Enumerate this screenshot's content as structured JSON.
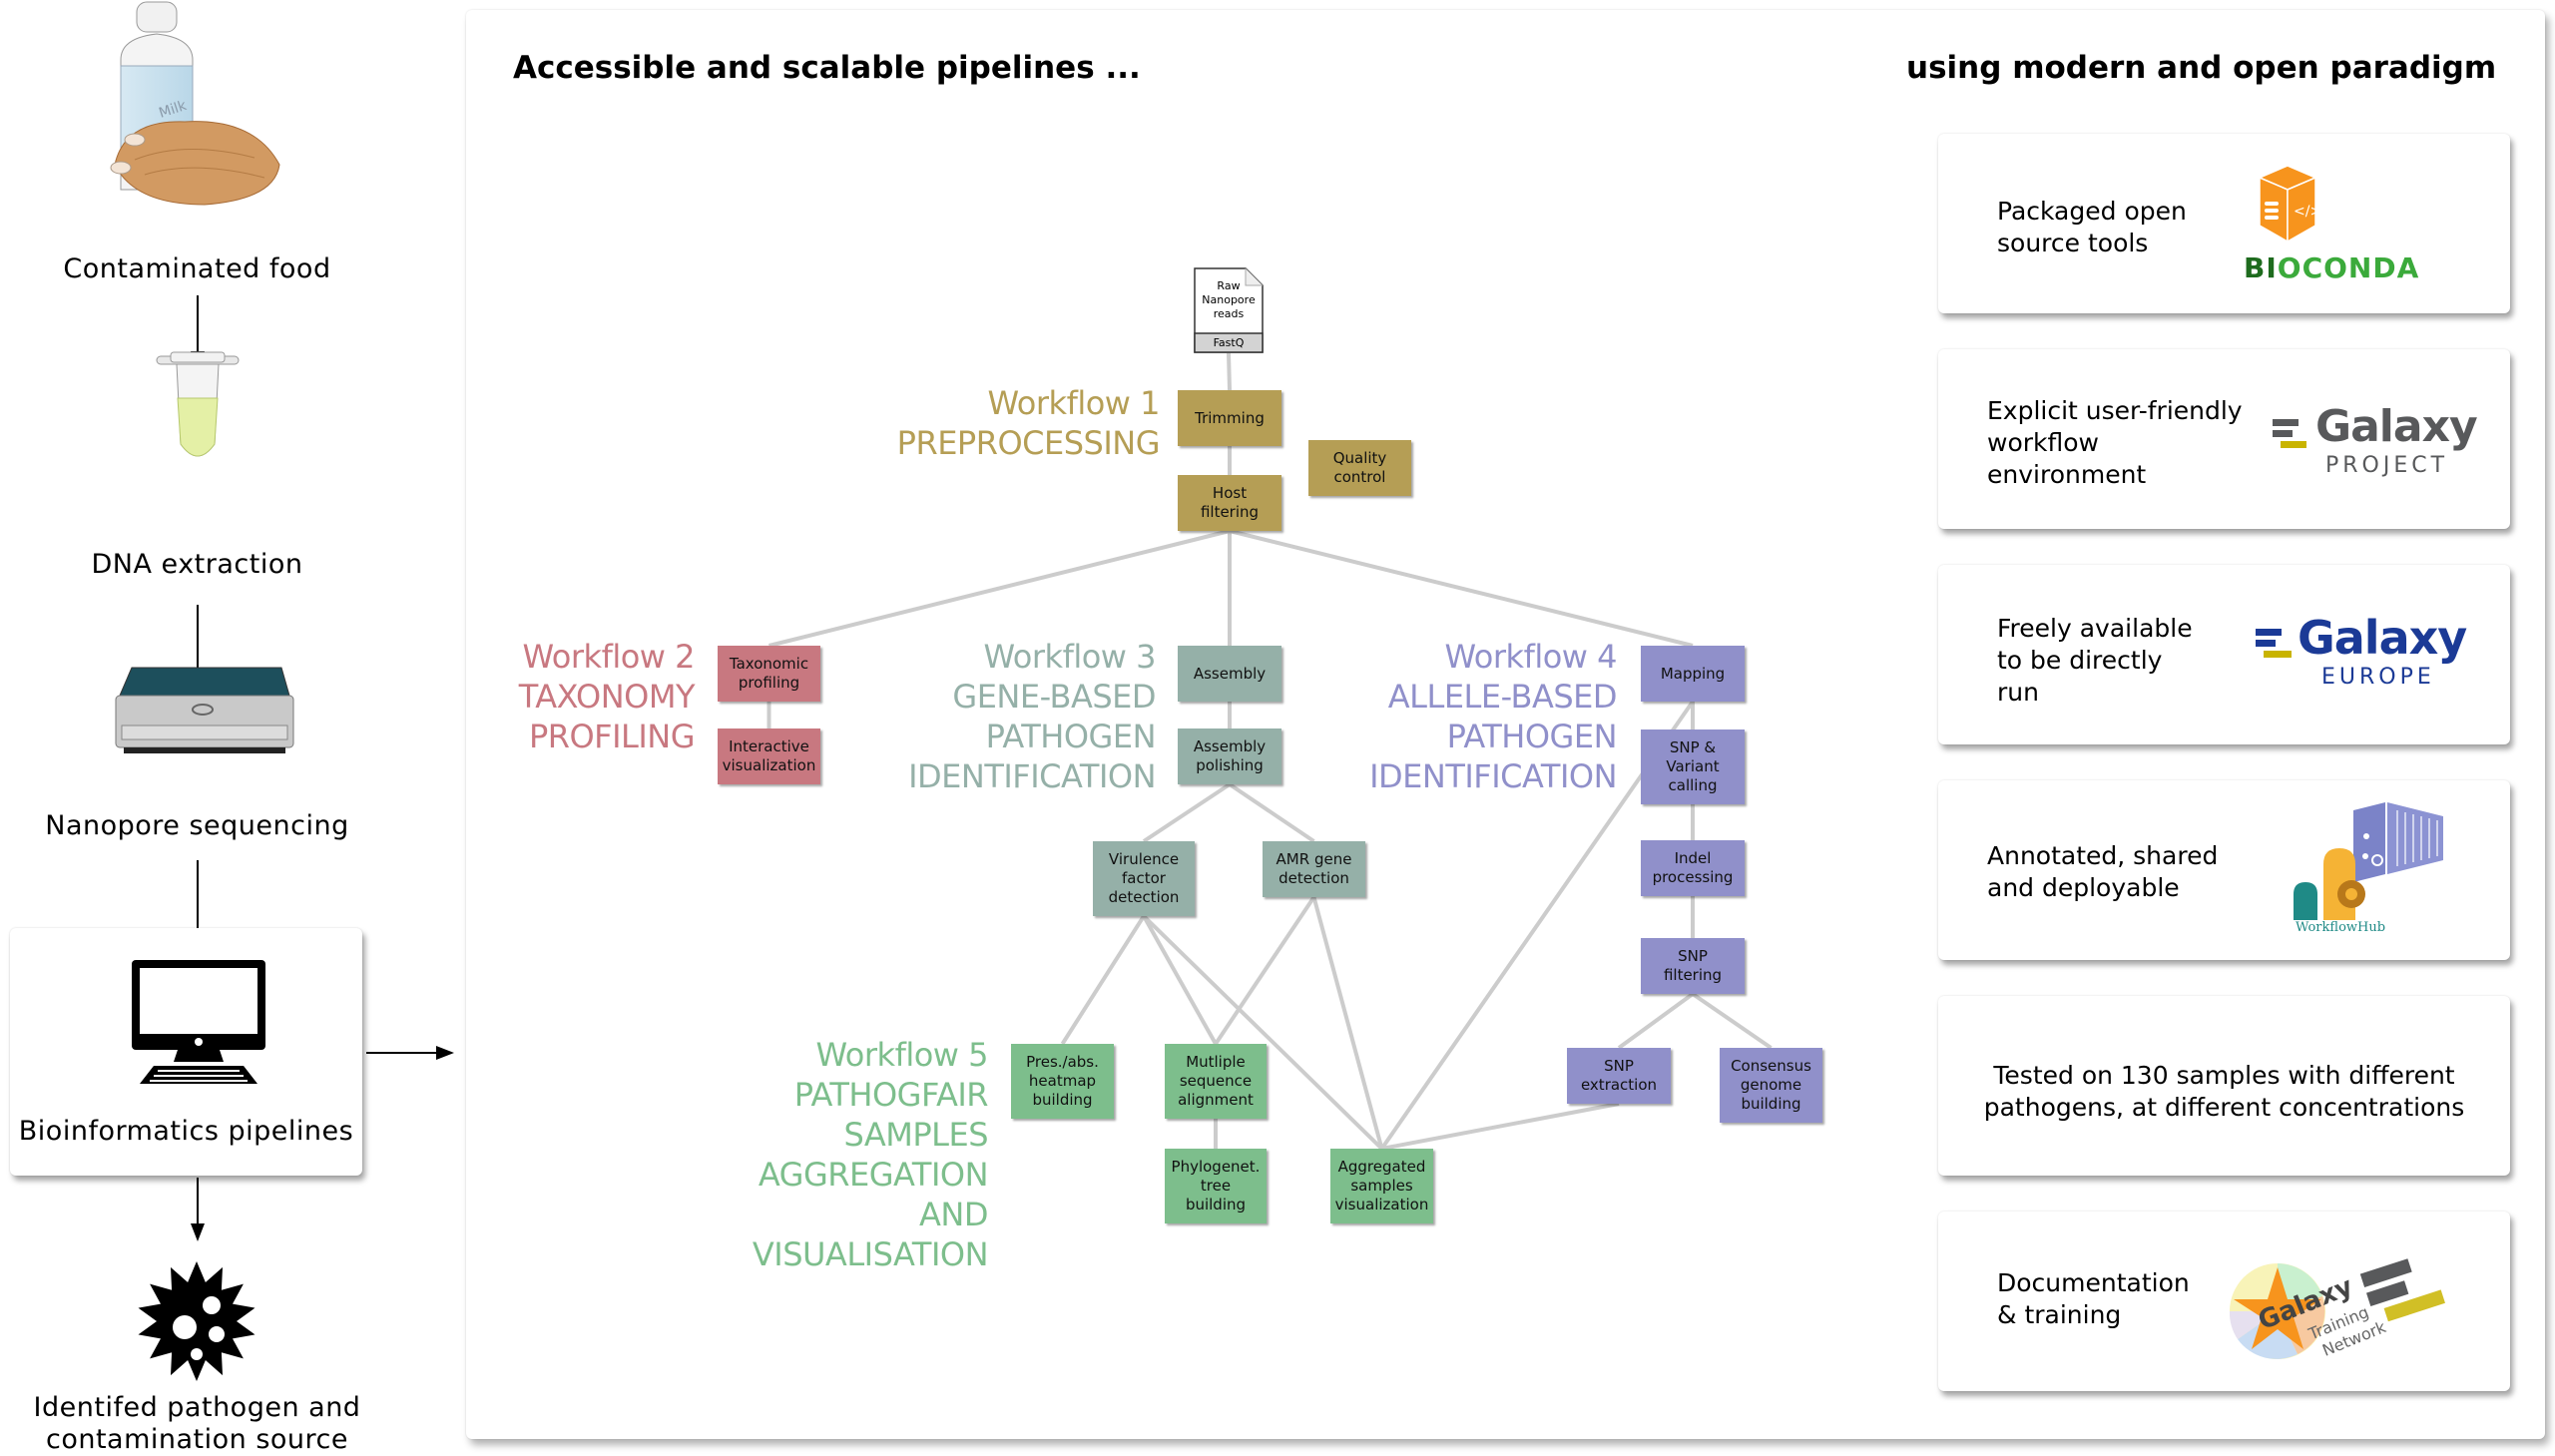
{
  "left_column": {
    "steps": [
      {
        "label": "Contaminated food",
        "icon": "food-milk-chicken-icon"
      },
      {
        "label": "DNA extraction",
        "icon": "tube-icon"
      },
      {
        "label": "Nanopore sequencing",
        "icon": "sequencer-icon"
      },
      {
        "label": "Bioinformatics pipelines",
        "icon": "computer-icon"
      },
      {
        "label": "Identifed pathogen and\ncontamination source",
        "icon": "pathogen-icon"
      }
    ],
    "milk_label": "Milk",
    "identified_line1": "Identifed pathogen and",
    "identified_line2": "contamination source"
  },
  "main": {
    "heading_left": "Accessible and scalable pipelines ...",
    "heading_right": "using modern and open paradigm"
  },
  "input_file": {
    "label": "Raw\nNanopore\nreads",
    "format": "FastQ"
  },
  "workflows": [
    {
      "id": "wf1",
      "title": "Workflow 1",
      "subtitle_lines": [
        "PREPROCESSING"
      ],
      "color": "#B59E55",
      "nodes": [
        {
          "id": "trimming",
          "label": "Trimming"
        },
        {
          "id": "host",
          "label": "Host\nfiltering"
        },
        {
          "id": "qc",
          "label": "Quality\ncontrol"
        }
      ]
    },
    {
      "id": "wf2",
      "title": "Workflow 2",
      "subtitle_lines": [
        "TAXONOMY",
        "PROFILING"
      ],
      "color": "#C87880",
      "nodes": [
        {
          "id": "tax",
          "label": "Taxonomic\nprofiling"
        },
        {
          "id": "interactive",
          "label": "Interactive\nvisualization"
        }
      ]
    },
    {
      "id": "wf3",
      "title": "Workflow 3",
      "subtitle_lines": [
        "GENE-BASED",
        "PATHOGEN",
        "IDENTIFICATION"
      ],
      "color": "#95B0A8",
      "nodes": [
        {
          "id": "assembly",
          "label": "Assembly"
        },
        {
          "id": "polish",
          "label": "Assembly\npolishing"
        },
        {
          "id": "vir",
          "label": "Virulence\nfactor\ndetection"
        },
        {
          "id": "amr",
          "label": "AMR gene\ndetection"
        }
      ]
    },
    {
      "id": "wf4",
      "title": "Workflow 4",
      "subtitle_lines": [
        "ALLELE-BASED",
        "PATHOGEN",
        "IDENTIFICATION"
      ],
      "color": "#9090CA",
      "nodes": [
        {
          "id": "mapping",
          "label": "Mapping"
        },
        {
          "id": "snpcall",
          "label": "SNP &\nVariant\ncalling"
        },
        {
          "id": "indel",
          "label": "Indel\nprocessing"
        },
        {
          "id": "snpfilt",
          "label": "SNP\nfiltering"
        },
        {
          "id": "snpext",
          "label": "SNP\nextraction"
        },
        {
          "id": "consensus",
          "label": "Consensus\ngenome\nbuilding"
        }
      ]
    },
    {
      "id": "wf5",
      "title": "Workflow 5",
      "subtitle_lines": [
        "PATHOGFAIR",
        "SAMPLES",
        "AGGREGATION",
        "AND",
        "VISUALISATION"
      ],
      "color": "#7DBE8C",
      "nodes": [
        {
          "id": "heatmap",
          "label": "Pres./abs.\nheatmap\nbuilding"
        },
        {
          "id": "msa",
          "label": "Mutliple\nsequence\nalignment"
        },
        {
          "id": "phylo",
          "label": "Phylogenet.\ntree\nbuilding"
        },
        {
          "id": "agg",
          "label": "Aggregated\nsamples\nvisualization"
        }
      ]
    }
  ],
  "edges": [
    [
      "input",
      "trimming"
    ],
    [
      "trimming",
      "host"
    ],
    [
      "host",
      "tax"
    ],
    [
      "host",
      "assembly"
    ],
    [
      "host",
      "mapping"
    ],
    [
      "tax",
      "interactive"
    ],
    [
      "assembly",
      "polish"
    ],
    [
      "polish",
      "vir"
    ],
    [
      "polish",
      "amr"
    ],
    [
      "mapping",
      "snpcall"
    ],
    [
      "snpcall",
      "indel"
    ],
    [
      "indel",
      "snpfilt"
    ],
    [
      "snpfilt",
      "snpext"
    ],
    [
      "snpfilt",
      "consensus"
    ],
    [
      "vir",
      "heatmap"
    ],
    [
      "vir",
      "msa"
    ],
    [
      "vir",
      "agg"
    ],
    [
      "amr",
      "msa"
    ],
    [
      "amr",
      "agg"
    ],
    [
      "msa",
      "phylo"
    ],
    [
      "mapping",
      "agg"
    ],
    [
      "snpext",
      "agg"
    ]
  ],
  "features": [
    {
      "text": "Packaged open\nsource tools",
      "logo": "bioconda-logo",
      "logo_text": "BIOCONDA"
    },
    {
      "text": "Explicit user-friendly\nworkflow\nenvironment",
      "logo": "galaxy-project-logo",
      "logo_text": "Galaxy",
      "logo_sub": "PROJECT"
    },
    {
      "text": "Freely available\nto be directly\nrun",
      "logo": "galaxy-europe-logo",
      "logo_text": "Galaxy",
      "logo_sub": "EUROPE"
    },
    {
      "text": "Annotated, shared\nand deployable",
      "logo": "workflowhub-logo",
      "logo_text": "WorkflowHub"
    },
    {
      "text": "Tested on 130 samples with different\npathogens, at different concentrations"
    },
    {
      "text": "Documentation\n& training",
      "logo": "galaxy-training-network-logo",
      "logo_text": "Galaxy",
      "logo_sub": "Training\nNetwork"
    }
  ],
  "colors": {
    "edge": "#CCCCCC",
    "bioconda_orange": "#F7941D",
    "bioconda_dark": "#1E6B1E",
    "bioconda_green": "#3BAA3B",
    "galaxy_gray": "#58595B",
    "galaxy_blue": "#1B3A96",
    "galaxy_gold": "#C9B400",
    "workflowhub_teal": "#1F8A86"
  }
}
